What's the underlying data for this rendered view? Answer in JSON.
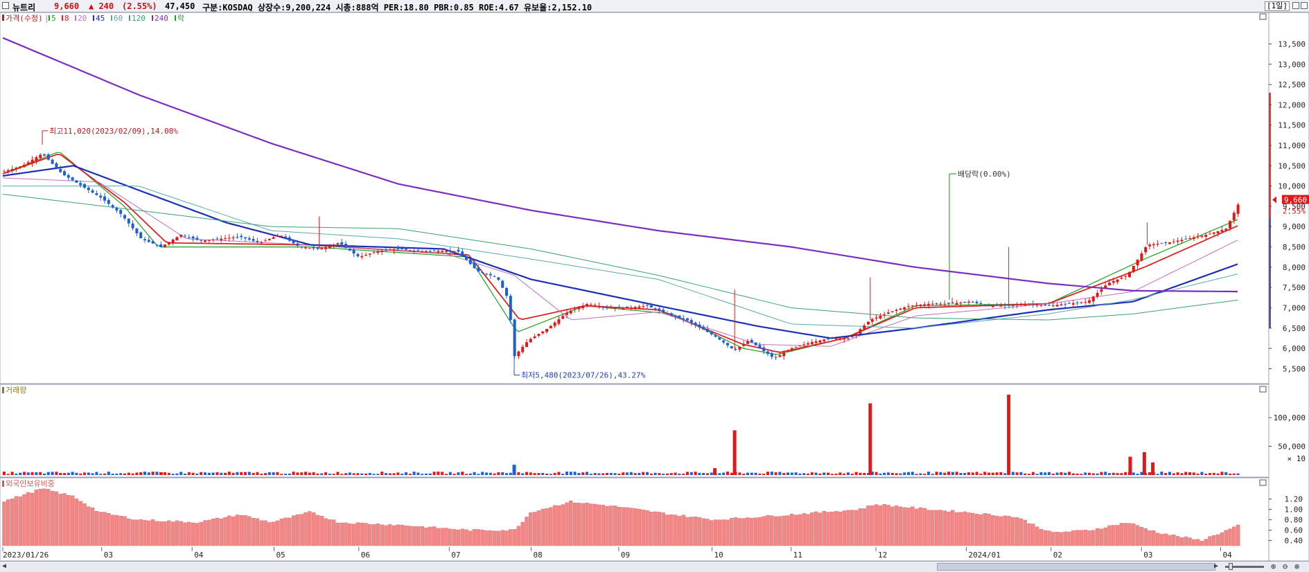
{
  "header": {
    "name": "뉴트리",
    "price": "9,660",
    "change": "▲ 240",
    "change_pct": "(2.55%)",
    "volume": "47,450",
    "info": "구분:KOSDAQ 상장수:9,200,224 시총:888억 PER:18.80 PBR:0.85 ROE:4.67 유보율:2,152.10",
    "period": "[1일]"
  },
  "legend": {
    "price_label": "가격(수정)",
    "ma": [
      {
        "label": "5",
        "color": "#1f9d1f"
      },
      {
        "label": "8",
        "color": "#dd2222"
      },
      {
        "label": "20",
        "color": "#c070c0"
      },
      {
        "label": "45",
        "color": "#1a2fb5"
      },
      {
        "label": "60",
        "color": "#5aa7b0"
      },
      {
        "label": "120",
        "color": "#3aa070"
      },
      {
        "label": "240",
        "color": "#7a2ec0"
      }
    ],
    "drop_label": "락"
  },
  "annotations": {
    "high": "최고11,020(2023/02/09),14.08%",
    "low": "최저5,480(2023/07/26),43.27%",
    "dividend": "배당락(0.00%)",
    "current_price": "9,660",
    "current_pct": "2.55%"
  },
  "volume_pane": {
    "title": "거래량",
    "multiplier": "× 10"
  },
  "foreign_pane": {
    "title": "외국인보유비중"
  },
  "chart_data": [
    {
      "type": "candlestick",
      "title": "가격(수정)",
      "ylim": [
        5200,
        13900
      ],
      "y_ticks": [
        "13,500",
        "13,000",
        "12,500",
        "12,000",
        "11,500",
        "11,000",
        "10,500",
        "10,000",
        "9,500",
        "9,000",
        "8,500",
        "8,000",
        "7,500",
        "7,000",
        "6,500",
        "6,000",
        "5,500"
      ],
      "y_tick_values": [
        13500,
        13000,
        12500,
        12000,
        11500,
        11000,
        10500,
        10000,
        9500,
        9000,
        8500,
        8000,
        7500,
        7000,
        6500,
        6000,
        5500
      ],
      "x_start": "2023-01-26",
      "x_end": "2024-04-08",
      "x_tick_labels": [
        "2023/01/26",
        "03",
        "04",
        "05",
        "06",
        "07",
        "08",
        "09",
        "10",
        "11",
        "12",
        "2024/01",
        "02",
        "03",
        "04"
      ],
      "x_tick_dates": [
        "2023-01-26",
        "2023-03-02",
        "2023-04-03",
        "2023-05-02",
        "2023-06-01",
        "2023-07-03",
        "2023-08-01",
        "2023-09-01",
        "2023-10-04",
        "2023-11-01",
        "2023-12-01",
        "2024-01-02",
        "2024-02-01",
        "2024-03-04",
        "2024-04-01"
      ],
      "close_path": [
        [
          "2023-01-26",
          10350
        ],
        [
          "2023-02-02",
          10500
        ],
        [
          "2023-02-09",
          10800
        ],
        [
          "2023-02-16",
          10300
        ],
        [
          "2023-02-23",
          10000
        ],
        [
          "2023-03-02",
          9700
        ],
        [
          "2023-03-09",
          9300
        ],
        [
          "2023-03-16",
          8700
        ],
        [
          "2023-03-23",
          8500
        ],
        [
          "2023-03-30",
          8800
        ],
        [
          "2023-04-06",
          8650
        ],
        [
          "2023-04-13",
          8700
        ],
        [
          "2023-04-20",
          8750
        ],
        [
          "2023-04-27",
          8600
        ],
        [
          "2023-05-04",
          8800
        ],
        [
          "2023-05-11",
          8500
        ],
        [
          "2023-05-18",
          8450
        ],
        [
          "2023-05-25",
          8600
        ],
        [
          "2023-06-01",
          8250
        ],
        [
          "2023-06-08",
          8400
        ],
        [
          "2023-06-15",
          8450
        ],
        [
          "2023-06-22",
          8400
        ],
        [
          "2023-06-29",
          8400
        ],
        [
          "2023-07-06",
          8400
        ],
        [
          "2023-07-13",
          7900
        ],
        [
          "2023-07-20",
          7750
        ],
        [
          "2023-07-24",
          7200
        ],
        [
          "2023-07-26",
          5800
        ],
        [
          "2023-07-31",
          6200
        ],
        [
          "2023-08-07",
          6500
        ],
        [
          "2023-08-14",
          6900
        ],
        [
          "2023-08-21",
          7100
        ],
        [
          "2023-08-28",
          7000
        ],
        [
          "2023-09-04",
          7000
        ],
        [
          "2023-09-11",
          7050
        ],
        [
          "2023-09-18",
          6850
        ],
        [
          "2023-09-25",
          6700
        ],
        [
          "2023-10-05",
          6300
        ],
        [
          "2023-10-12",
          5950
        ],
        [
          "2023-10-17",
          6200
        ],
        [
          "2023-10-20",
          6050
        ],
        [
          "2023-10-26",
          5750
        ],
        [
          "2023-11-01",
          6000
        ],
        [
          "2023-11-08",
          6150
        ],
        [
          "2023-11-15",
          6250
        ],
        [
          "2023-11-22",
          6250
        ],
        [
          "2023-11-29",
          6700
        ],
        [
          "2023-12-06",
          6900
        ],
        [
          "2023-12-13",
          7050
        ],
        [
          "2023-12-20",
          7100
        ],
        [
          "2023-12-27",
          7100
        ],
        [
          "2024-01-03",
          7150
        ],
        [
          "2024-01-10",
          7050
        ],
        [
          "2024-01-17",
          7050
        ],
        [
          "2024-01-24",
          7100
        ],
        [
          "2024-01-31",
          7050
        ],
        [
          "2024-02-07",
          7100
        ],
        [
          "2024-02-14",
          7150
        ],
        [
          "2024-02-21",
          7600
        ],
        [
          "2024-02-28",
          7800
        ],
        [
          "2024-03-06",
          8550
        ],
        [
          "2024-03-13",
          8600
        ],
        [
          "2024-03-20",
          8700
        ],
        [
          "2024-03-27",
          8800
        ],
        [
          "2024-04-03",
          8950
        ],
        [
          "2024-04-08",
          9660
        ]
      ],
      "ma_paths": {
        "240": [
          [
            "2023-01-26",
            13650
          ],
          [
            "2023-03-15",
            12250
          ],
          [
            "2023-05-01",
            11050
          ],
          [
            "2023-06-15",
            10050
          ],
          [
            "2023-08-01",
            9400
          ],
          [
            "2023-09-15",
            8900
          ],
          [
            "2023-11-01",
            8500
          ],
          [
            "2023-12-15",
            8000
          ],
          [
            "2024-01-31",
            7600
          ],
          [
            "2024-03-01",
            7420
          ],
          [
            "2024-04-08",
            7400
          ]
        ],
        "120": [
          [
            "2023-01-26",
            9800
          ],
          [
            "2023-03-15",
            9400
          ],
          [
            "2023-05-01",
            9000
          ],
          [
            "2023-06-15",
            8950
          ],
          [
            "2023-08-01",
            8450
          ],
          [
            "2023-09-15",
            7800
          ],
          [
            "2023-11-01",
            7000
          ],
          [
            "2023-12-15",
            6750
          ],
          [
            "2024-01-31",
            6700
          ],
          [
            "2024-03-01",
            6850
          ],
          [
            "2024-04-08",
            7200
          ]
        ],
        "60": [
          [
            "2023-01-26",
            10000
          ],
          [
            "2023-03-15",
            10000
          ],
          [
            "2023-05-01",
            8900
          ],
          [
            "2023-06-15",
            8700
          ],
          [
            "2023-08-01",
            8200
          ],
          [
            "2023-09-15",
            7700
          ],
          [
            "2023-11-01",
            6600
          ],
          [
            "2023-12-15",
            6500
          ],
          [
            "2024-01-31",
            6850
          ],
          [
            "2024-03-01",
            7200
          ],
          [
            "2024-04-08",
            7850
          ]
        ],
        "45": [
          [
            "2023-01-26",
            10250
          ],
          [
            "2023-02-20",
            10500
          ],
          [
            "2023-03-15",
            9900
          ],
          [
            "2023-04-15",
            9100
          ],
          [
            "2023-05-15",
            8550
          ],
          [
            "2023-07-01",
            8450
          ],
          [
            "2023-08-01",
            7700
          ],
          [
            "2023-09-15",
            7050
          ],
          [
            "2023-10-20",
            6550
          ],
          [
            "2023-11-15",
            6250
          ],
          [
            "2023-12-15",
            6500
          ],
          [
            "2024-01-31",
            6950
          ],
          [
            "2024-03-01",
            7150
          ],
          [
            "2024-04-08",
            8100
          ]
        ],
        "20": [
          [
            "2023-01-26",
            10200
          ],
          [
            "2023-03-01",
            10100
          ],
          [
            "2023-04-01",
            8700
          ],
          [
            "2023-05-15",
            8550
          ],
          [
            "2023-07-01",
            8350
          ],
          [
            "2023-07-26",
            7800
          ],
          [
            "2023-08-15",
            6700
          ],
          [
            "2023-09-15",
            6900
          ],
          [
            "2023-10-20",
            6100
          ],
          [
            "2023-11-15",
            6050
          ],
          [
            "2023-12-15",
            6800
          ],
          [
            "2024-01-31",
            7100
          ],
          [
            "2024-03-01",
            7400
          ],
          [
            "2024-04-08",
            8700
          ]
        ],
        "8": [
          [
            "2023-01-26",
            10300
          ],
          [
            "2023-02-15",
            10800
          ],
          [
            "2023-03-10",
            9600
          ],
          [
            "2023-03-25",
            8600
          ],
          [
            "2023-05-15",
            8550
          ],
          [
            "2023-07-10",
            8300
          ],
          [
            "2023-07-28",
            6700
          ],
          [
            "2023-08-20",
            7050
          ],
          [
            "2023-09-15",
            6950
          ],
          [
            "2023-10-15",
            6100
          ],
          [
            "2023-10-28",
            5900
          ],
          [
            "2023-11-20",
            6250
          ],
          [
            "2023-12-15",
            7000
          ],
          [
            "2024-01-31",
            7100
          ],
          [
            "2024-03-05",
            8000
          ],
          [
            "2024-04-08",
            9050
          ]
        ],
        "5": [
          [
            "2023-01-26",
            10300
          ],
          [
            "2023-02-15",
            10850
          ],
          [
            "2023-03-10",
            9500
          ],
          [
            "2023-03-22",
            8500
          ],
          [
            "2023-05-15",
            8500
          ],
          [
            "2023-07-10",
            8250
          ],
          [
            "2023-07-27",
            6400
          ],
          [
            "2023-08-20",
            7050
          ],
          [
            "2023-09-20",
            6850
          ],
          [
            "2023-10-15",
            6000
          ],
          [
            "2023-10-27",
            5850
          ],
          [
            "2023-11-20",
            6250
          ],
          [
            "2023-12-15",
            7050
          ],
          [
            "2024-01-31",
            7100
          ],
          [
            "2024-03-05",
            8200
          ],
          [
            "2024-04-08",
            9200
          ]
        ]
      }
    },
    {
      "type": "bar",
      "title": "거래량",
      "units": "× 10",
      "y_ticks": [
        "100,000",
        "50,000"
      ],
      "y_tick_values": [
        100000,
        50000
      ],
      "ylim": [
        0,
        140000
      ],
      "spikes": [
        [
          "2023-03-23",
          5000
        ],
        [
          "2023-07-26",
          18000
        ],
        [
          "2023-10-05",
          12000
        ],
        [
          "2023-10-12",
          78000
        ],
        [
          "2023-11-29",
          125000
        ],
        [
          "2024-01-17",
          140000
        ],
        [
          "2024-02-29",
          32000
        ],
        [
          "2024-03-05",
          40000
        ],
        [
          "2024-03-08",
          22000
        ]
      ],
      "baseline": 4000
    },
    {
      "type": "bar",
      "title": "외국인보유비중",
      "y_ticks": [
        "1.20",
        "1.00",
        "0.80",
        "0.60",
        "0.40"
      ],
      "y_tick_values": [
        1.2,
        1.0,
        0.8,
        0.6,
        0.4
      ],
      "ylim": [
        0.3,
        1.45
      ],
      "path": [
        [
          "2023-01-26",
          1.15
        ],
        [
          "2023-02-09",
          1.4
        ],
        [
          "2023-02-20",
          1.25
        ],
        [
          "2023-03-01",
          0.95
        ],
        [
          "2023-03-15",
          0.8
        ],
        [
          "2023-04-05",
          0.75
        ],
        [
          "2023-04-20",
          0.9
        ],
        [
          "2023-05-01",
          0.75
        ],
        [
          "2023-05-15",
          0.95
        ],
        [
          "2023-05-25",
          0.75
        ],
        [
          "2023-06-15",
          0.7
        ],
        [
          "2023-07-10",
          0.6
        ],
        [
          "2023-07-26",
          0.6
        ],
        [
          "2023-08-01",
          0.95
        ],
        [
          "2023-08-15",
          1.15
        ],
        [
          "2023-09-01",
          1.05
        ],
        [
          "2023-09-20",
          0.9
        ],
        [
          "2023-10-05",
          0.8
        ],
        [
          "2023-11-01",
          0.9
        ],
        [
          "2023-11-25",
          1.0
        ],
        [
          "2023-12-01",
          1.1
        ],
        [
          "2023-12-20",
          1.0
        ],
        [
          "2024-01-01",
          0.95
        ],
        [
          "2024-01-20",
          0.85
        ],
        [
          "2024-02-01",
          0.55
        ],
        [
          "2024-02-15",
          0.6
        ],
        [
          "2024-02-28",
          0.75
        ],
        [
          "2024-03-10",
          0.55
        ],
        [
          "2024-03-25",
          0.4
        ],
        [
          "2024-04-08",
          0.7
        ]
      ]
    }
  ]
}
